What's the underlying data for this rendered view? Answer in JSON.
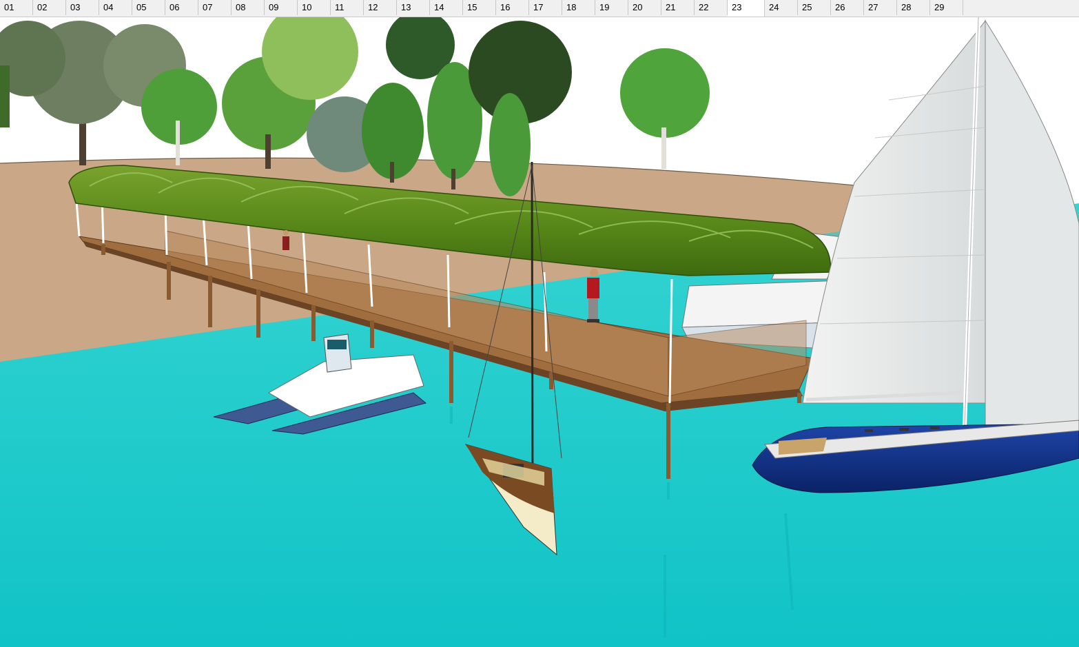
{
  "app": {
    "active_scene": "23"
  },
  "scene_tabs": [
    {
      "label": "01"
    },
    {
      "label": "02"
    },
    {
      "label": "03"
    },
    {
      "label": "04"
    },
    {
      "label": "05"
    },
    {
      "label": "06"
    },
    {
      "label": "07"
    },
    {
      "label": "08"
    },
    {
      "label": "09"
    },
    {
      "label": "10"
    },
    {
      "label": "11"
    },
    {
      "label": "12"
    },
    {
      "label": "13"
    },
    {
      "label": "14"
    },
    {
      "label": "15"
    },
    {
      "label": "16"
    },
    {
      "label": "17"
    },
    {
      "label": "18"
    },
    {
      "label": "19"
    },
    {
      "label": "20"
    },
    {
      "label": "21"
    },
    {
      "label": "22"
    },
    {
      "label": "23"
    },
    {
      "label": "24"
    },
    {
      "label": "25"
    },
    {
      "label": "26"
    },
    {
      "label": "27"
    },
    {
      "label": "28"
    },
    {
      "label": "29"
    }
  ],
  "colors": {
    "water": "#16c7c9",
    "sand": "#caa887",
    "roof": "#5e8a1f",
    "deck": "#a06d3f",
    "hull_blue": "#0f2f86"
  }
}
